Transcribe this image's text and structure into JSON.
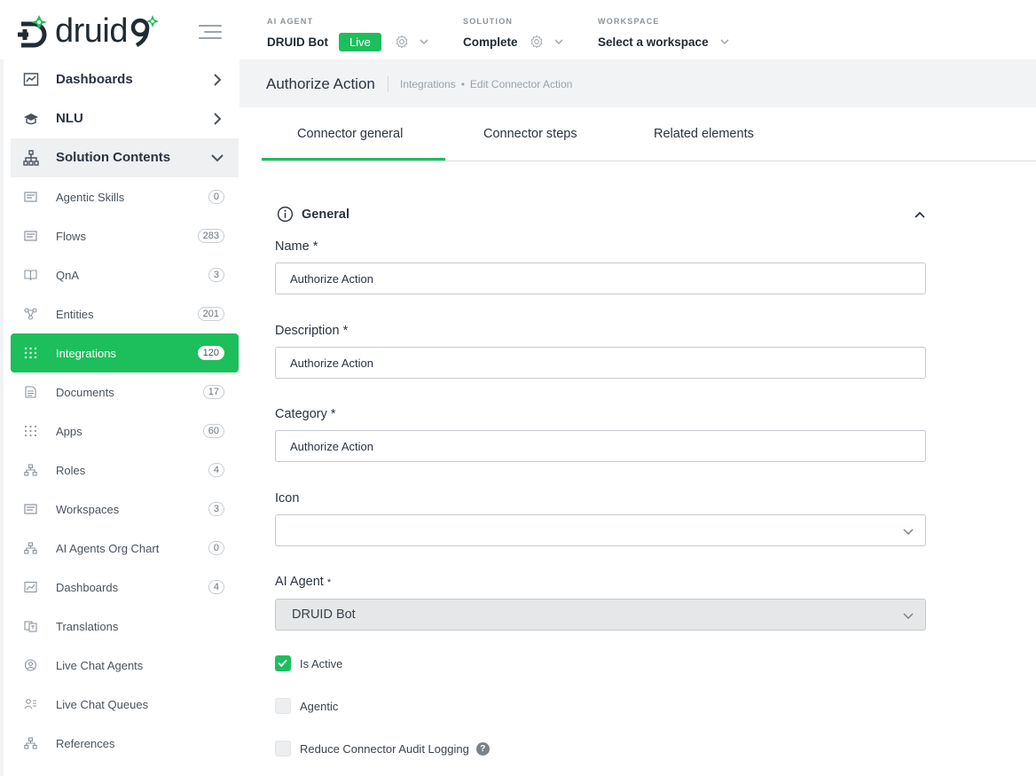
{
  "brand": {
    "name": "druid",
    "accent_color": "#1cbf5c",
    "logo_icon": "druid-logo-icon"
  },
  "topbar": {
    "ai_agent": {
      "label": "AI AGENT",
      "value": "DRUID Bot",
      "status": "Live"
    },
    "solution": {
      "label": "SOLUTION",
      "value": "Complete"
    },
    "workspace": {
      "label": "WORKSPACE",
      "value": "Select a workspace"
    }
  },
  "sidebar": {
    "dashboards": "Dashboards",
    "nlu": "NLU",
    "solution_contents": "Solution Contents",
    "items": [
      {
        "label": "Agentic Skills",
        "count": "0",
        "icon": "skills-icon"
      },
      {
        "label": "Flows",
        "count": "283",
        "icon": "flows-icon"
      },
      {
        "label": "QnA",
        "count": "3",
        "icon": "book-icon"
      },
      {
        "label": "Entities",
        "count": "201",
        "icon": "entities-icon"
      },
      {
        "label": "Integrations",
        "count": "120",
        "icon": "grid-dots-icon",
        "active": true
      },
      {
        "label": "Documents",
        "count": "17",
        "icon": "document-icon"
      },
      {
        "label": "Apps",
        "count": "60",
        "icon": "apps-icon"
      },
      {
        "label": "Roles",
        "count": "4",
        "icon": "org-icon"
      },
      {
        "label": "Workspaces",
        "count": "3",
        "icon": "workspace-icon"
      },
      {
        "label": "AI Agents Org Chart",
        "count": "0",
        "icon": "org-chart-icon"
      },
      {
        "label": "Dashboards",
        "count": "4",
        "icon": "chart-icon"
      },
      {
        "label": "Translations",
        "count": "",
        "icon": "translate-icon"
      },
      {
        "label": "Live Chat Agents",
        "count": "",
        "icon": "agent-icon"
      },
      {
        "label": "Live Chat Queues",
        "count": "",
        "icon": "queue-icon"
      },
      {
        "label": "References",
        "count": "",
        "icon": "references-icon"
      }
    ]
  },
  "page": {
    "title": "Authorize Action",
    "breadcrumb": [
      "Integrations",
      "Edit Connector Action"
    ]
  },
  "tabs": {
    "general": "Connector general",
    "steps": "Connector steps",
    "related": "Related elements"
  },
  "form": {
    "section_title": "General",
    "name_label": "Name",
    "name_value": "Authorize Action",
    "description_label": "Description",
    "description_value": "Authorize Action",
    "category_label": "Category",
    "category_value": "Authorize Action",
    "icon_label": "Icon",
    "icon_value": "",
    "ai_agent_label": "AI Agent",
    "ai_agent_value": "DRUID Bot",
    "is_active_label": "Is Active",
    "is_active": true,
    "agentic_label": "Agentic",
    "agentic": false,
    "reduce_logging_label": "Reduce Connector Audit Logging",
    "reduce_logging": false,
    "required_mark": "*",
    "help_glyph": "?"
  }
}
